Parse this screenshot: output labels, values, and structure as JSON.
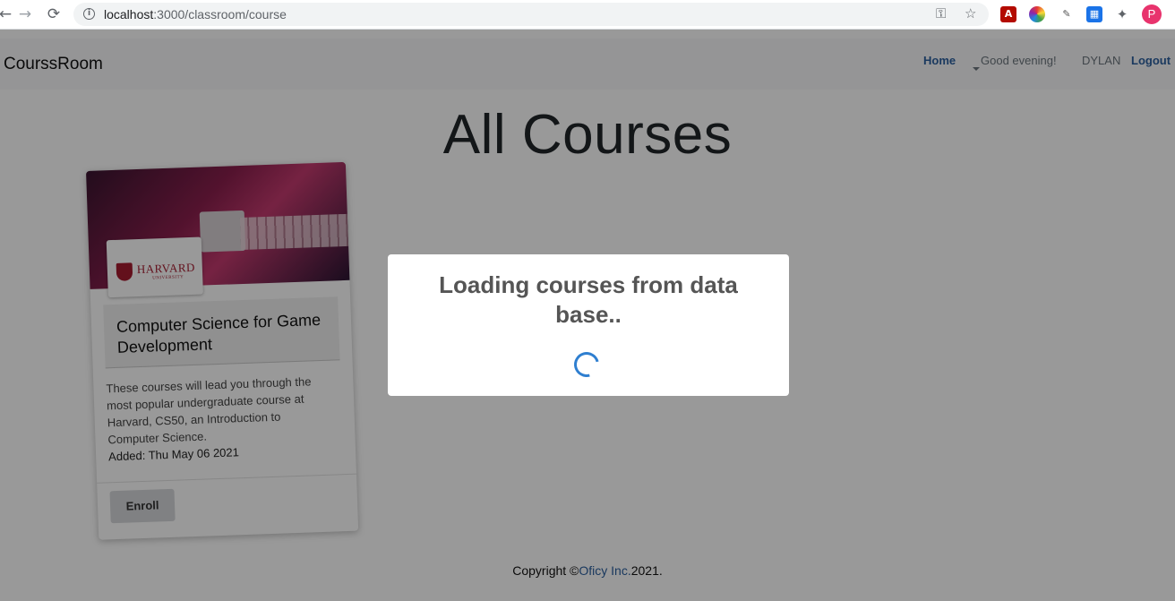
{
  "browser": {
    "url_host": "localhost",
    "url_path": ":3000/classroom/course",
    "icons": [
      "back-icon",
      "forward-icon",
      "reload-icon",
      "info-icon",
      "key-icon",
      "star-icon"
    ],
    "avatar_letter": "P"
  },
  "navbar": {
    "brand": "CourssRoom",
    "home": "Home",
    "greeting": "Good evening!",
    "user": "DYLAN",
    "logout": "Logout"
  },
  "main": {
    "heading": "All Courses"
  },
  "card": {
    "logo_text": "HARVARD",
    "logo_sub": "UNIVERSITY",
    "title": "Computer Science for Game Development",
    "description": "These courses will lead you through the most popular undergraduate course at Harvard, CS50, an Introduction to Computer Science.",
    "added": "Added: Thu May 06 2021",
    "enroll": "Enroll"
  },
  "footer": {
    "prefix": "Copyright ©",
    "company": "Oficy Inc.",
    "suffix": "2021."
  },
  "modal": {
    "message": "Loading courses from data base.."
  },
  "colors": {
    "link": "#2c5f9e",
    "spinner": "#2f7fd0",
    "avatar": "#e8336d"
  }
}
